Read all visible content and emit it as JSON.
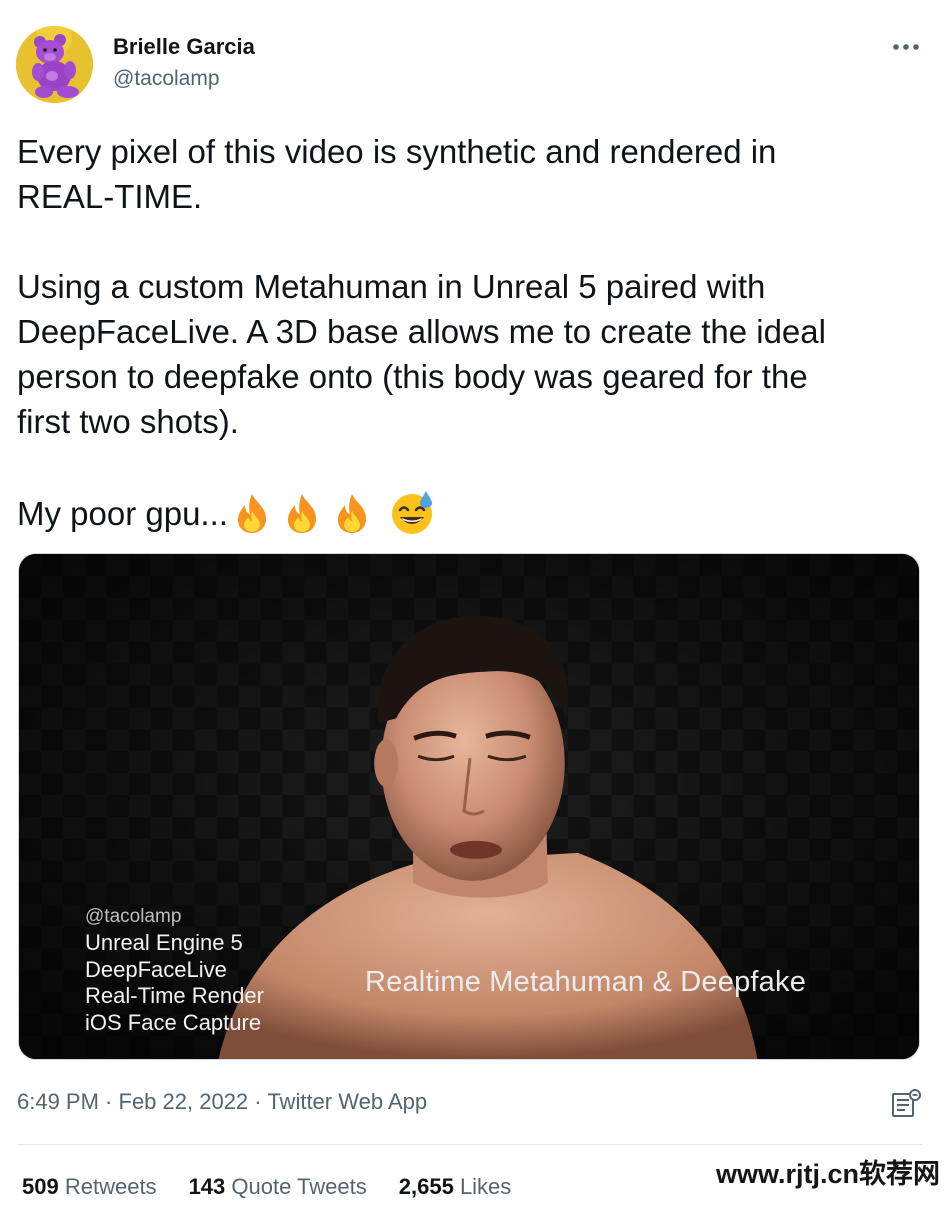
{
  "author": {
    "display_name": "Brielle Garcia",
    "handle": "@tacolamp",
    "avatar_icon": "purple-teddy-bear-avatar"
  },
  "tweet": {
    "lines_para1": [
      "Every pixel of this video is synthetic and rendered in",
      "REAL-TIME."
    ],
    "lines_para2": [
      "Using a custom Metahuman in Unreal 5 paired with",
      "DeepFaceLive. A 3D base allows me to create the ideal",
      "person to deepfake onto (this body was geared for the",
      "first two shots)."
    ],
    "para3_text": "My poor gpu...",
    "para3_emojis": [
      "fire-emoji",
      "fire-emoji",
      "fire-emoji",
      "sweat-smile-emoji"
    ]
  },
  "media": {
    "overlay_handle": "@tacolamp",
    "overlay_lines": [
      "Unreal Engine 5",
      "DeepFaceLive",
      "Real-Time Render",
      "iOS Face Capture"
    ],
    "overlay_title": "Realtime Metahuman & Deepfake"
  },
  "meta": {
    "time": "6:49 PM",
    "date": "Feb 22, 2022",
    "source": "Twitter Web App",
    "separator": " · "
  },
  "stats": {
    "retweets_count": "509",
    "retweets_label": "Retweets",
    "quotes_count": "143",
    "quotes_label": "Quote Tweets",
    "likes_count": "2,655",
    "likes_label": "Likes"
  },
  "watermark": {
    "text": "www.rjtj.cn软荐网"
  },
  "colors": {
    "text_primary": "#0f1419",
    "text_secondary": "#536471",
    "divider": "#e3e8eb"
  }
}
